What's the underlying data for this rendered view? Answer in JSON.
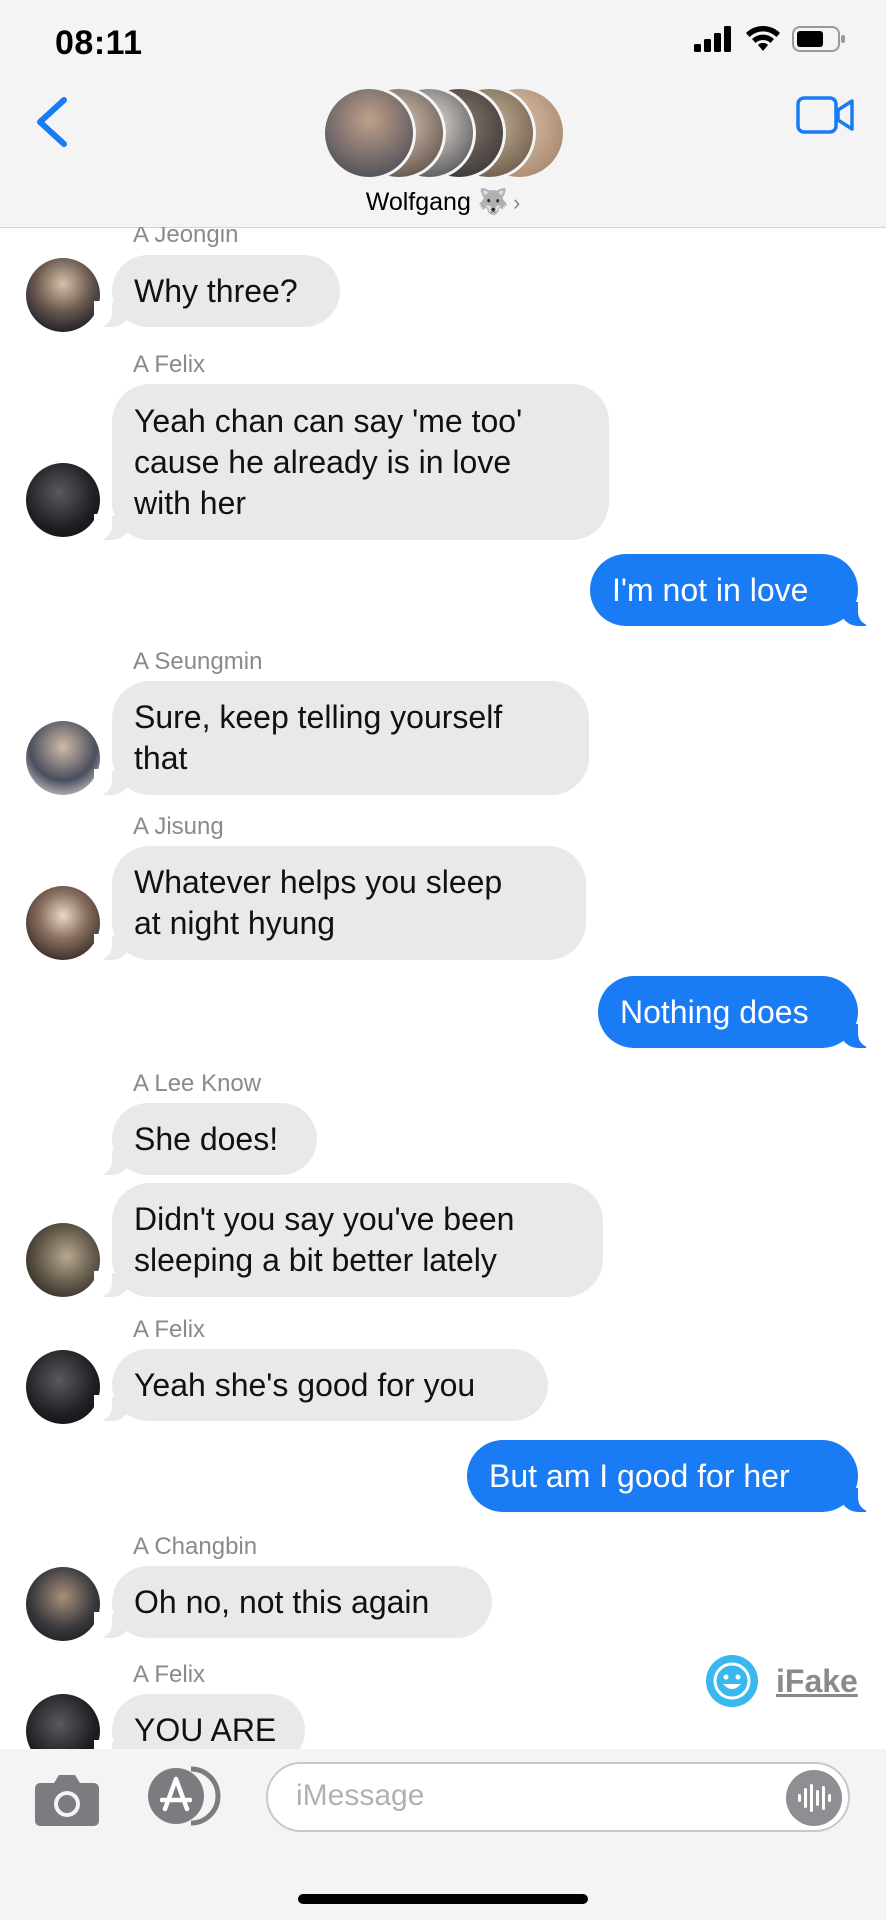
{
  "status": {
    "time": "08:11"
  },
  "header": {
    "group_name": "Wolfgang 🐺",
    "chevron": "›"
  },
  "messages": {
    "m1": {
      "sender": "A Jeongin",
      "text": "Why three?"
    },
    "m2": {
      "sender": "A Felix",
      "lines": [
        "Yeah chan can say 'me too'",
        "cause he already is in love",
        "with her"
      ]
    },
    "m3": {
      "text": "I'm not in love"
    },
    "m4": {
      "sender": "A Seungmin",
      "lines": [
        "Sure, keep telling yourself",
        "that"
      ]
    },
    "m5": {
      "sender": "A Jisung",
      "lines": [
        "Whatever helps you sleep",
        "at night hyung"
      ]
    },
    "m6": {
      "text": "Nothing does"
    },
    "m7": {
      "sender": "A Lee Know",
      "text": "She does!"
    },
    "m8": {
      "lines": [
        "Didn't you say you've been",
        "sleeping a bit better lately"
      ]
    },
    "m9": {
      "sender": "A Felix",
      "text": "Yeah she's good for you"
    },
    "m10": {
      "text": "But am I good for her"
    },
    "m11": {
      "sender": "A Changbin",
      "text": "Oh no, not this again"
    },
    "m12": {
      "sender": "A Felix",
      "text": "YOU ARE"
    }
  },
  "watermark": {
    "label": "iFake"
  },
  "input": {
    "placeholder": "iMessage"
  },
  "colors": {
    "accent": "#1a7cf5",
    "incoming_bubble": "#e9e9eb",
    "header_bg": "#f4f4f5"
  }
}
